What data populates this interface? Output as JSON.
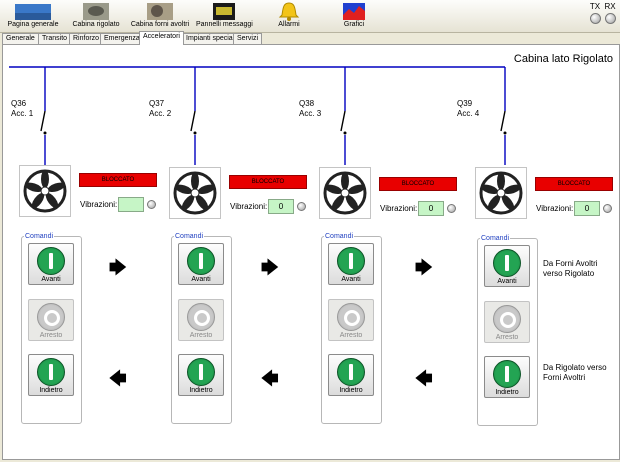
{
  "toolbar": {
    "items": [
      {
        "label": "Pagina generale",
        "icon": "overview-icon"
      },
      {
        "label": "Cabina rigolato",
        "icon": "machine-photo-icon"
      },
      {
        "label": "Cabina forni avoltri",
        "icon": "furnace-photo-icon"
      },
      {
        "label": "Pannelli messaggi",
        "icon": "message-panel-icon"
      },
      {
        "label": "Allarmi",
        "icon": "bell-icon"
      },
      {
        "label": "Grafici",
        "icon": "chart-icon"
      }
    ],
    "tx": "TX",
    "rx": "RX"
  },
  "tabs": [
    "Generale",
    "Transito",
    "Rinforzo",
    "Emergenza",
    "Acceleratori",
    "Impianti speciali",
    "Servizi"
  ],
  "active_tab": "Acceleratori",
  "title": "Cabina lato Rigolato",
  "units": [
    {
      "q": "Q36",
      "acc": "Acc. 1",
      "status": "BLOCCATO",
      "vib_label": "Vibrazioni:",
      "vib_value": ""
    },
    {
      "q": "Q37",
      "acc": "Acc. 2",
      "status": "BLOCCATO",
      "vib_label": "Vibrazioni:",
      "vib_value": "0"
    },
    {
      "q": "Q38",
      "acc": "Acc. 3",
      "status": "BLOCCATO",
      "vib_label": "Vibrazioni:",
      "vib_value": "0"
    },
    {
      "q": "Q39",
      "acc": "Acc. 4",
      "status": "BLOCCATO",
      "vib_label": "Vibrazioni:",
      "vib_value": "0"
    }
  ],
  "commands": {
    "title": "Comandi",
    "avanti": "Avanti",
    "arresto": "Arresto",
    "indietro": "Indietro"
  },
  "arrows": {
    "forward": "🡆",
    "back": "🡄"
  },
  "notes": {
    "forward": "Da Forni Avoltri verso Rigolato",
    "back": "Da Rigolato verso Forni Avoltri"
  },
  "colors": {
    "bus": "#0000c0",
    "blocked": "#e80000",
    "vibration_ok": "#c6f5c6",
    "start_green": "#23a453"
  }
}
